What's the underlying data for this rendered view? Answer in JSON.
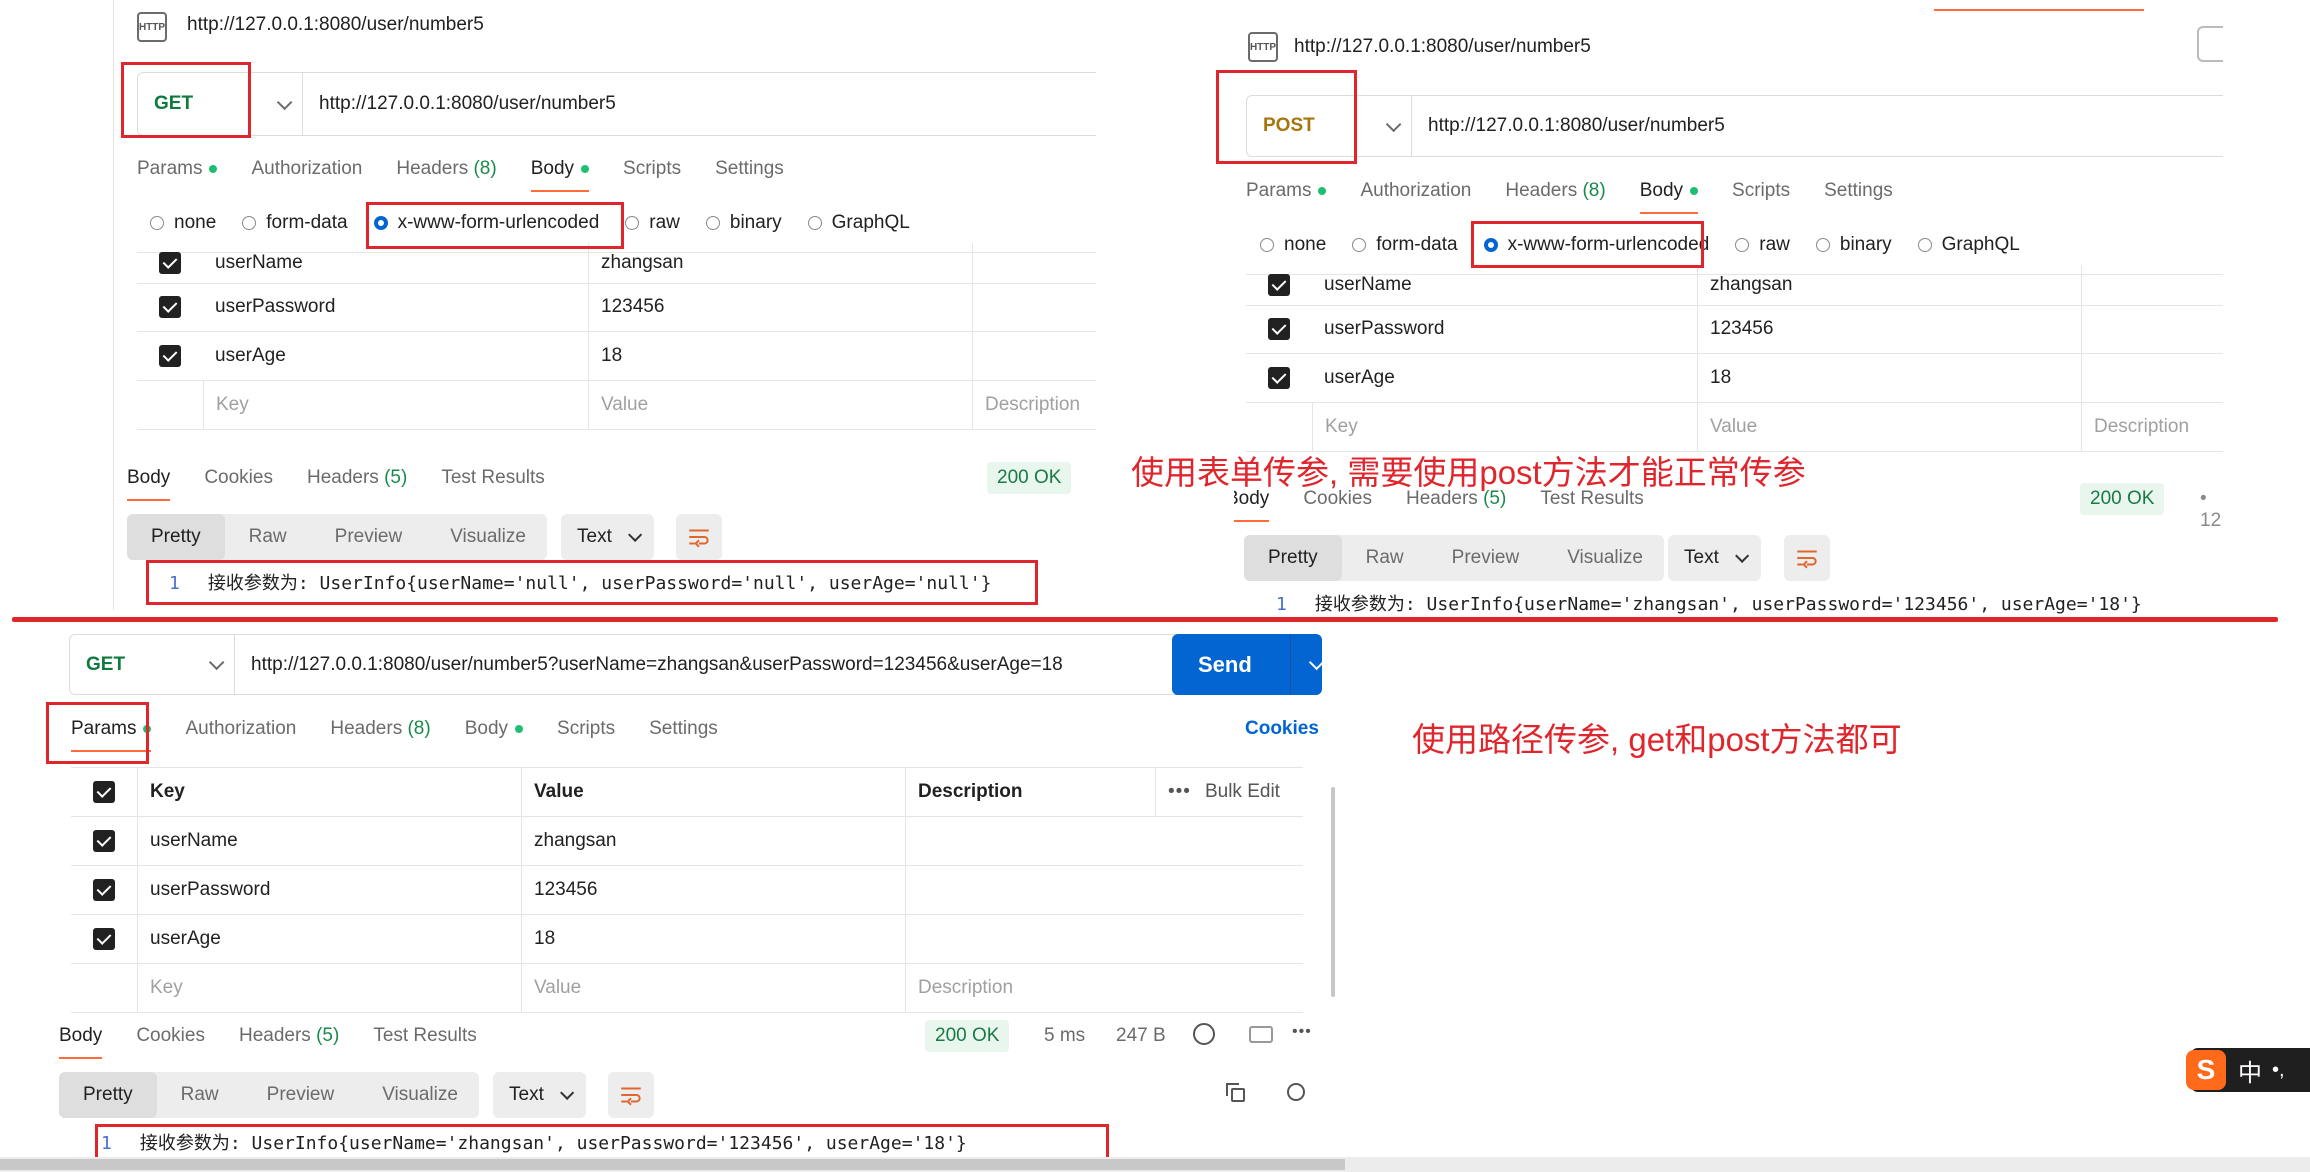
{
  "top_left": {
    "request_name": "http://127.0.0.1:8080/user/number5",
    "method": "GET",
    "url": "http://127.0.0.1:8080/user/number5",
    "tabs": [
      "Params",
      "Authorization",
      "Headers",
      "Body",
      "Scripts",
      "Settings"
    ],
    "headers_count": "(8)",
    "body_types": [
      "none",
      "form-data",
      "x-www-form-urlencoded",
      "raw",
      "binary",
      "GraphQL"
    ],
    "rows": [
      {
        "key": "userName",
        "value": "zhangsan"
      },
      {
        "key": "userPassword",
        "value": "123456"
      },
      {
        "key": "userAge",
        "value": "18"
      }
    ],
    "placeholders": {
      "key": "Key",
      "value": "Value",
      "description": "Description"
    },
    "resp_tabs": [
      "Body",
      "Cookies",
      "Headers",
      "Test Results"
    ],
    "resp_headers_count": "(5)",
    "status": "200 OK",
    "view_modes": [
      "Pretty",
      "Raw",
      "Preview",
      "Visualize"
    ],
    "format": "Text",
    "line_no": "1",
    "response": "接收参数为: UserInfo{userName='null', userPassword='null', userAge='null'}"
  },
  "top_right": {
    "request_name": "http://127.0.0.1:8080/user/number5",
    "method": "POST",
    "url": "http://127.0.0.1:8080/user/number5",
    "tabs": [
      "Params",
      "Authorization",
      "Headers",
      "Body",
      "Scripts",
      "Settings"
    ],
    "headers_count": "(8)",
    "body_types": [
      "none",
      "form-data",
      "x-www-form-urlencoded",
      "raw",
      "binary",
      "GraphQL"
    ],
    "rows": [
      {
        "key": "userName",
        "value": "zhangsan"
      },
      {
        "key": "userPassword",
        "value": "123456"
      },
      {
        "key": "userAge",
        "value": "18"
      }
    ],
    "placeholders": {
      "key": "Key",
      "value": "Value",
      "description": "Description"
    },
    "resp_tabs": [
      "Body",
      "Cookies",
      "Headers",
      "Test Results"
    ],
    "resp_headers_count": "(5)",
    "status": "200 OK",
    "status_extra": "12",
    "view_modes": [
      "Pretty",
      "Raw",
      "Preview",
      "Visualize"
    ],
    "format": "Text",
    "line_no": "1",
    "response": "接收参数为: UserInfo{userName='zhangsan', userPassword='123456', userAge='18'}"
  },
  "annotation_form": "使用表单传参, 需要使用post方法才能正常传参",
  "annotation_path": "使用路径传参, get和post方法都可",
  "bottom": {
    "method": "GET",
    "url": "http://127.0.0.1:8080/user/number5?userName=zhangsan&userPassword=123456&userAge=18",
    "send": "Send",
    "tabs": [
      "Params",
      "Authorization",
      "Headers",
      "Body",
      "Scripts",
      "Settings"
    ],
    "headers_count": "(8)",
    "cookies": "Cookies",
    "columns": [
      "Key",
      "Value",
      "Description"
    ],
    "bulk_edit": "Bulk Edit",
    "rows": [
      {
        "key": "userName",
        "value": "zhangsan"
      },
      {
        "key": "userPassword",
        "value": "123456"
      },
      {
        "key": "userAge",
        "value": "18"
      }
    ],
    "placeholders": {
      "key": "Key",
      "value": "Value",
      "description": "Description"
    },
    "resp_tabs": [
      "Body",
      "Cookies",
      "Headers",
      "Test Results"
    ],
    "resp_headers_count": "(5)",
    "status": "200 OK",
    "time": "5 ms",
    "size": "247 B",
    "view_modes": [
      "Pretty",
      "Raw",
      "Preview",
      "Visualize"
    ],
    "format": "Text",
    "line_no": "1",
    "response": "接收参数为: UserInfo{userName='zhangsan', userPassword='123456', userAge='18'}"
  },
  "ime": {
    "label": "中",
    "punct": "•,"
  },
  "colors": {
    "accent": "#ff6c37",
    "annotation": "#e0262d",
    "get": "#0f7a3d",
    "post": "#a6750b",
    "send": "#0265d2"
  }
}
